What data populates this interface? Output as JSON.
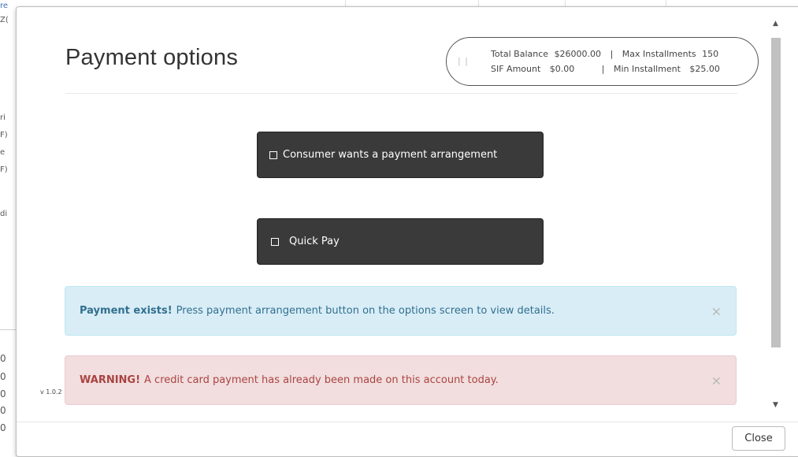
{
  "background": {
    "fragments": [
      "re",
      "Z(",
      "ri",
      "F)",
      "e",
      "F)",
      "di",
      "0",
      "0",
      "0",
      "0",
      "0"
    ]
  },
  "modal": {
    "title": "Payment options",
    "summary": {
      "total_balance_label": "Total Balance",
      "total_balance_value": "$26000.00",
      "max_installments_label": "Max Installments",
      "max_installments_value": "150",
      "sif_amount_label": "SIF Amount",
      "sif_amount_value": "$0.00",
      "min_installment_label": "Min Installment",
      "min_installment_value": "$25.00",
      "separator": "|",
      "bars": "| |"
    },
    "buttons": {
      "arrangement_label": "Consumer wants a payment arrangement",
      "quick_pay_label": "Quick Pay"
    },
    "alerts": {
      "info_strong": "Payment exists!",
      "info_text": "Press payment arrangement button on the options screen to view details.",
      "warning_strong": "WARNING!",
      "warning_text": "A credit card payment has already been made on this account today.",
      "dismiss_glyph": "×"
    },
    "version": "v 1.0.2",
    "close_label": "Close"
  },
  "colors": {
    "button_dark": "#3a3a3a",
    "info_bg": "#d9edf7",
    "info_text": "#31708f",
    "danger_bg": "#f2dede",
    "danger_text": "#a94442"
  }
}
